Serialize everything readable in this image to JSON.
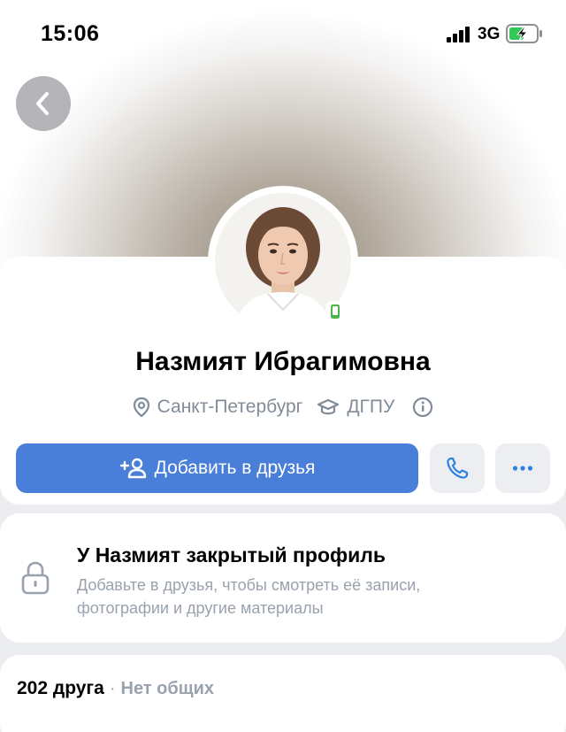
{
  "status_bar": {
    "time": "15:06",
    "network": "3G"
  },
  "icons": {
    "back": "chevron-left-icon",
    "location": "location-pin-icon",
    "education": "graduation-cap-icon",
    "info": "info-icon",
    "add_friend": "add-user-icon",
    "call": "phone-icon",
    "more": "more-horizontal-icon",
    "lock": "lock-icon",
    "online_mobile": "mobile-online-icon"
  },
  "colors": {
    "accent": "#4a7fd9",
    "online": "#4bb34b",
    "secondary_text": "#818c99"
  },
  "profile": {
    "name": "Назмият Ибрагимовна",
    "city": "Санкт-Петербург",
    "university": "ДГПУ"
  },
  "actions": {
    "add_friend_label": "Добавить в друзья"
  },
  "closed_profile": {
    "title": "У Назмият закрытый профиль",
    "line1": "Добавьте в друзья, чтобы смотреть её записи,",
    "line2": "фотографии и другие материалы"
  },
  "friends": {
    "count": "202 друга",
    "separator": "·",
    "mutual": "Нет общих"
  }
}
